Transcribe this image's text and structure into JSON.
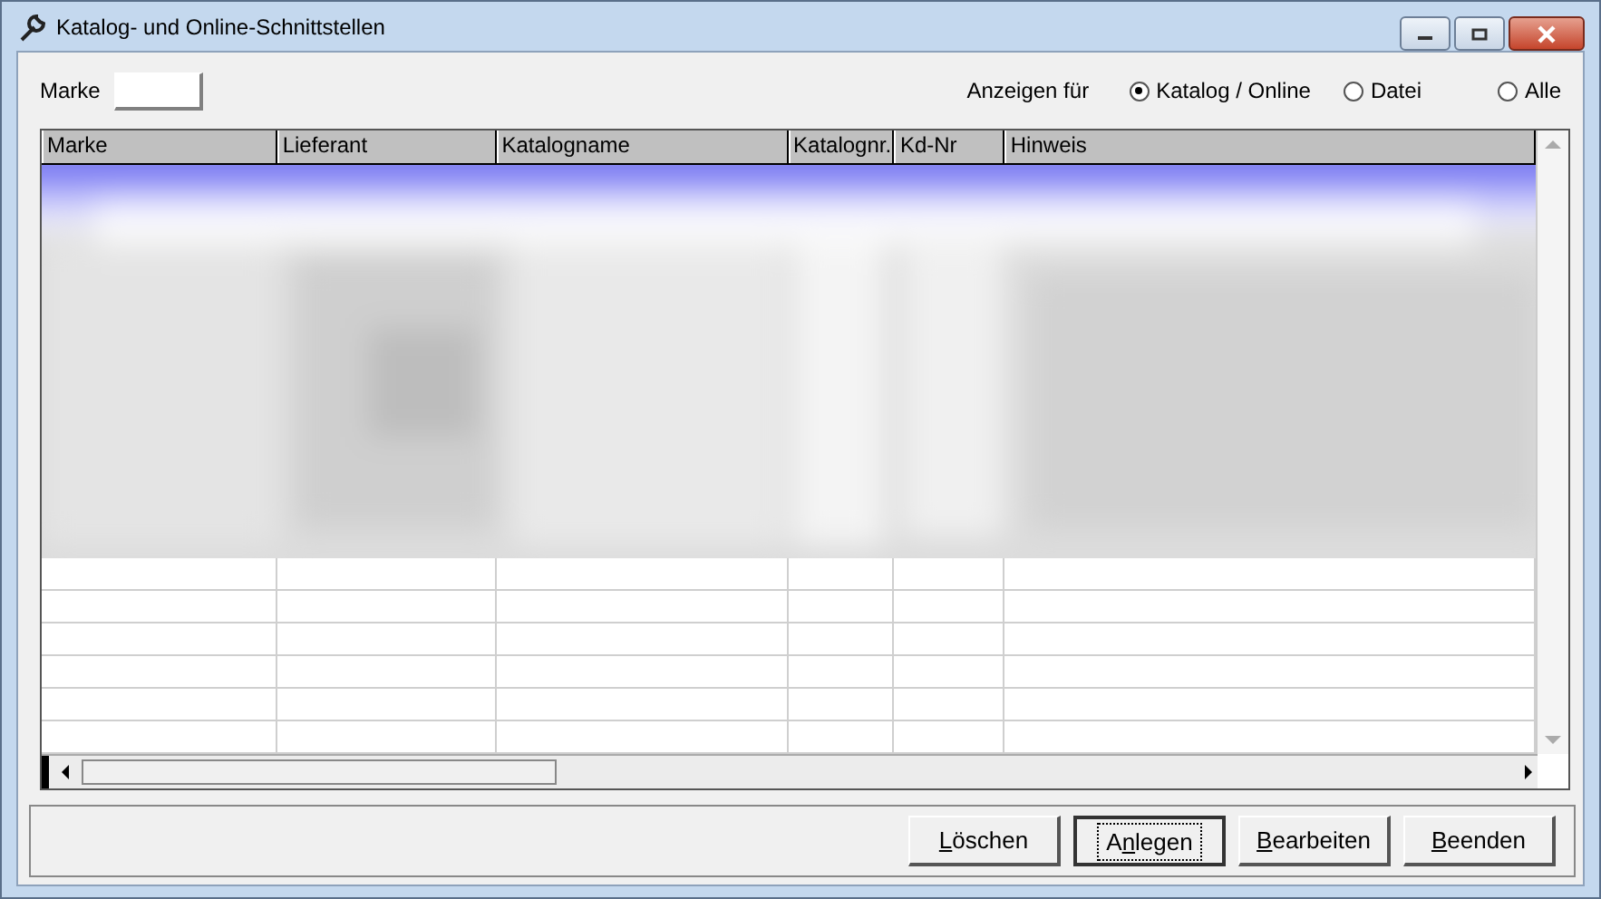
{
  "window": {
    "title": "Katalog- und Online-Schnittstellen"
  },
  "filter": {
    "label": "Marke"
  },
  "display": {
    "label": "Anzeigen für",
    "options": [
      {
        "label": "Katalog / Online",
        "selected": true
      },
      {
        "label": "Datei",
        "selected": false
      },
      {
        "label": "Alle",
        "selected": false
      }
    ]
  },
  "table": {
    "columns": [
      "Marke",
      "Lieferant",
      "Katalogname",
      "Katalognr.",
      "Kd-Nr",
      "Hinweis"
    ]
  },
  "buttons": [
    {
      "key": "L",
      "post": "öschen",
      "focused": false
    },
    {
      "pre": "A",
      "key": "n",
      "post": "legen",
      "focused": true
    },
    {
      "key": "B",
      "post": "earbeiten",
      "focused": false
    },
    {
      "key": "B",
      "post": "eenden",
      "focused": false
    }
  ]
}
